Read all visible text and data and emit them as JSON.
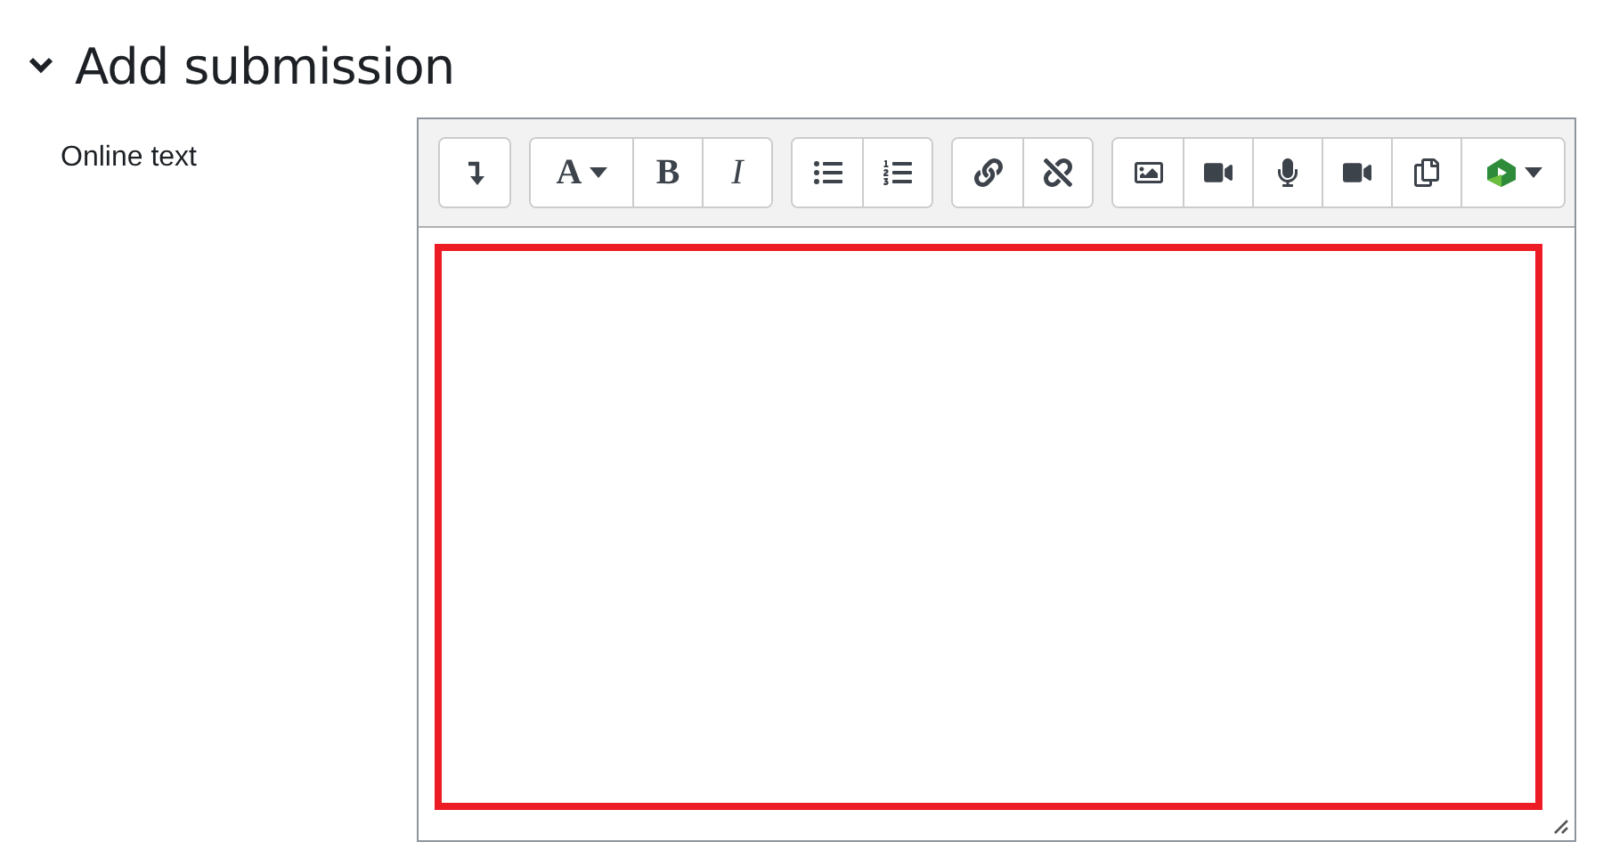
{
  "section": {
    "title": "Add submission",
    "expanded": true
  },
  "field": {
    "label": "Online text"
  },
  "toolbar": [
    {
      "buttons": [
        {
          "kind": "icon",
          "menu": false
        }
      ]
    },
    {
      "buttons": [
        {
          "kind": "text",
          "label": "A",
          "menu": true
        },
        {
          "kind": "text",
          "label": "B",
          "menu": false
        },
        {
          "kind": "text",
          "label": "I",
          "menu": false
        }
      ]
    },
    {
      "buttons": [
        {
          "kind": "icon",
          "menu": false
        },
        {
          "kind": "icon",
          "menu": false
        }
      ]
    },
    {
      "buttons": [
        {
          "kind": "icon",
          "menu": false
        },
        {
          "kind": "icon",
          "menu": false
        }
      ]
    },
    {
      "buttons": [
        {
          "kind": "icon",
          "menu": false
        },
        {
          "kind": "icon",
          "menu": false
        },
        {
          "kind": "icon",
          "menu": false
        },
        {
          "kind": "icon",
          "menu": false
        },
        {
          "kind": "icon",
          "menu": false
        },
        {
          "kind": "icon",
          "menu": true
        }
      ]
    }
  ],
  "editor": {
    "highlighted": true
  }
}
